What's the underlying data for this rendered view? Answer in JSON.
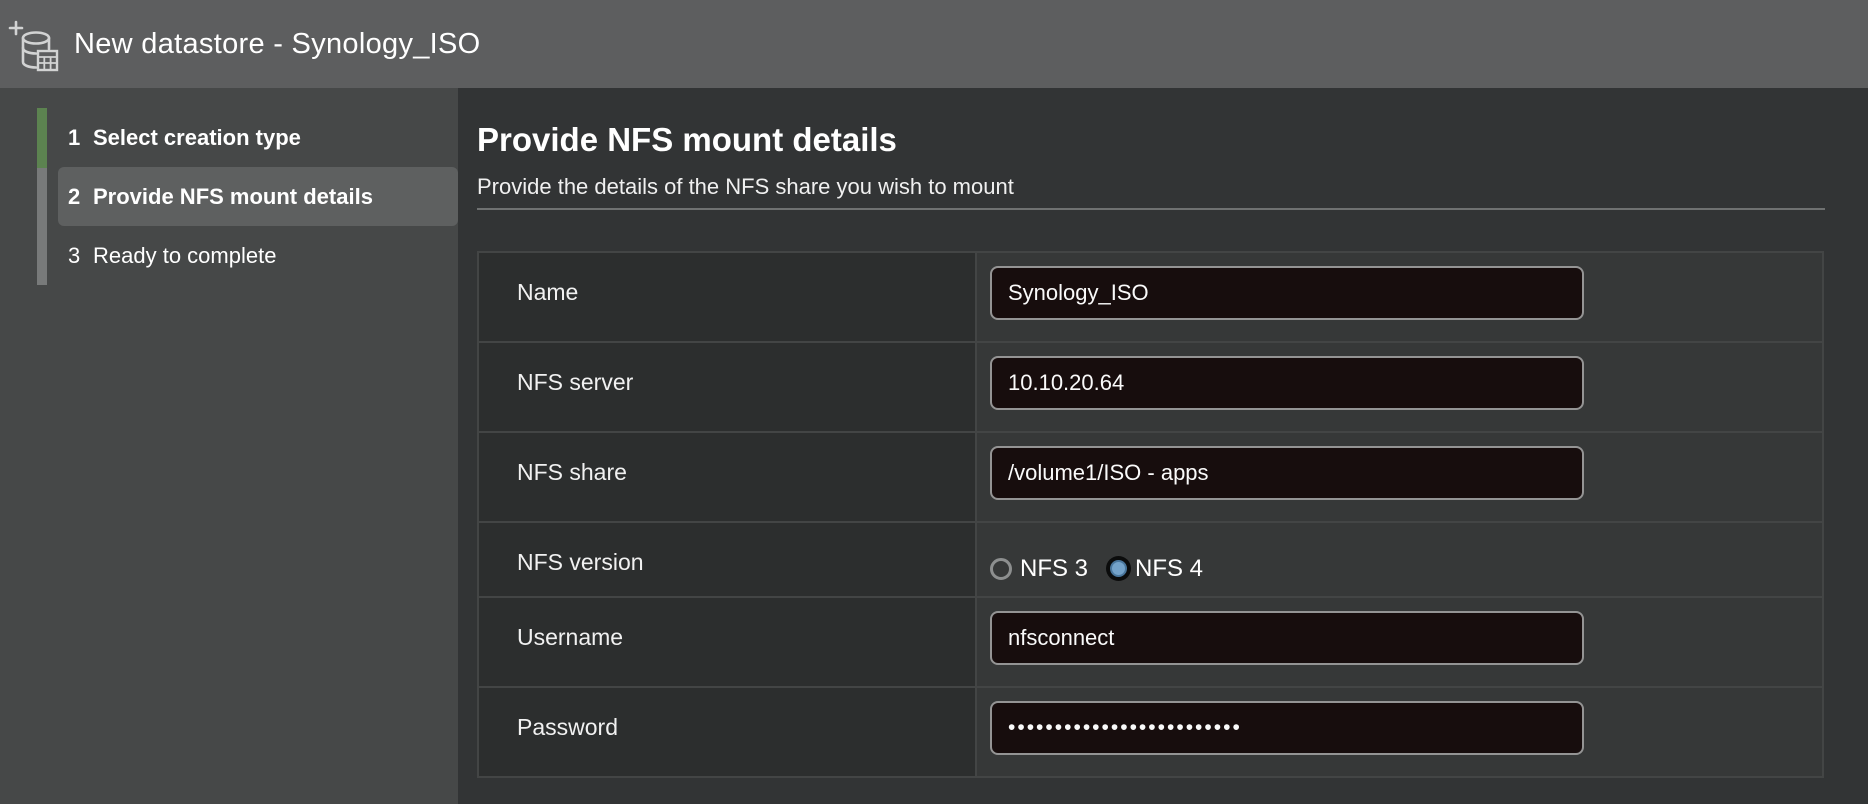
{
  "window": {
    "title": "New datastore - Synology_ISO",
    "icon": "datastore-add-icon"
  },
  "wizard": {
    "steps": [
      {
        "number": "1",
        "label": "Select creation type",
        "state": "completed"
      },
      {
        "number": "2",
        "label": "Provide NFS mount details",
        "state": "current"
      },
      {
        "number": "3",
        "label": "Ready to complete",
        "state": "upcoming"
      }
    ]
  },
  "content": {
    "heading": "Provide NFS mount details",
    "subheading": "Provide the details of the NFS share you wish to mount",
    "form": {
      "fields": [
        {
          "label": "Name",
          "type": "text",
          "value": "Synology_ISO"
        },
        {
          "label": "NFS server",
          "type": "text",
          "value": "10.10.20.64"
        },
        {
          "label": "NFS share",
          "type": "text",
          "value": "/volume1/ISO - apps"
        },
        {
          "label": "NFS version",
          "type": "radio",
          "options": [
            {
              "label": "NFS 3",
              "selected": false
            },
            {
              "label": "NFS 4",
              "selected": true
            }
          ]
        },
        {
          "label": "Username",
          "type": "text",
          "value": "nfsconnect"
        },
        {
          "label": "Password",
          "type": "password",
          "value": "•••••••••••••••••••••••••"
        }
      ]
    }
  },
  "colors": {
    "titlebar_bg": "#5d5e5f",
    "sidebar_bg": "#464848",
    "step_current_bg": "#5e6060",
    "progress_completed": "#5c8350",
    "progress_remaining": "#787a7a",
    "main_bg": "#323435",
    "label_cell_bg": "#2c2e2e",
    "value_cell_bg": "#363838",
    "input_bg": "#170d0d",
    "input_border": "#949494",
    "radio_selected_fill": "#74a3ca"
  }
}
